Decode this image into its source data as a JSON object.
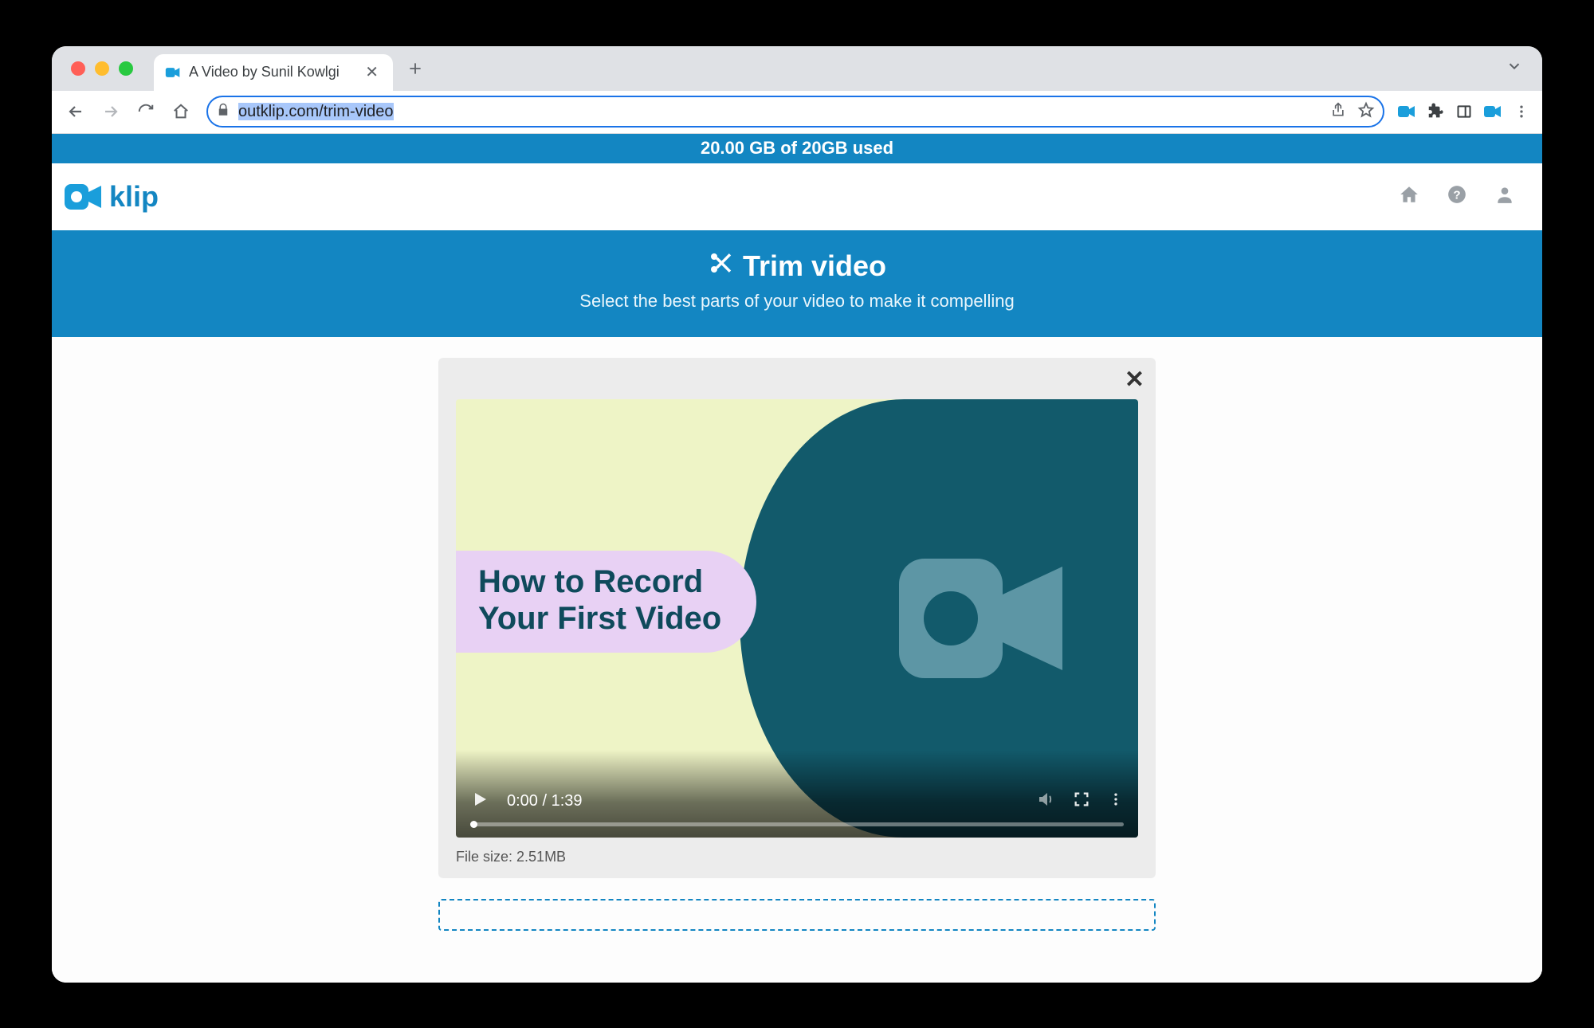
{
  "browser": {
    "tab_title": "A Video by Sunil Kowlgi",
    "url_host": "outklip.com",
    "url_path": "/trim-video"
  },
  "storage_banner": "20.00 GB of 20GB used",
  "logo_text": "klip",
  "hero": {
    "title": "Trim video",
    "subtitle": "Select the best parts of your video to make it compelling"
  },
  "video": {
    "thumbnail_title": "How to Record\nYour First Video",
    "current_time": "0:00",
    "duration": "1:39"
  },
  "file": {
    "size_label": "File size:",
    "size_value": "2.51MB"
  }
}
